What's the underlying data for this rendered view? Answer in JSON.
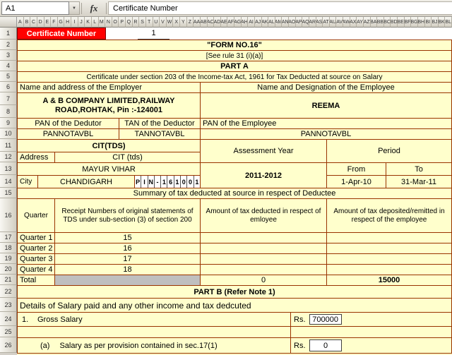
{
  "window": {
    "formula_bar": {
      "cell_reference": "A1",
      "dropdown_icon": "▼",
      "fx_label": "fx",
      "formula_content": "Certificate Number"
    },
    "grid": {
      "column_headers": [
        "A",
        "B",
        "C",
        "D",
        "E",
        "F",
        "G",
        "H",
        "I",
        "J",
        "K",
        "L",
        "M",
        "N",
        "O",
        "P",
        "Q",
        "R",
        "S",
        "T",
        "U",
        "V",
        "W",
        "X",
        "Y",
        "Z",
        "AA",
        "AB",
        "AC",
        "AD",
        "AE",
        "AF",
        "AG",
        "AH",
        "AI",
        "AJ",
        "AK",
        "AL",
        "AM",
        "AN",
        "AO",
        "AP",
        "AQ",
        "AR",
        "AS",
        "AT",
        "AU",
        "AV",
        "AW",
        "AX",
        "AY",
        "AZ",
        "BA",
        "BB",
        "BC",
        "BD",
        "BE",
        "BF",
        "BG",
        "BH",
        "BI",
        "BJ",
        "BK",
        "BL"
      ],
      "row_headers": [
        "1",
        "2",
        "3",
        "4",
        "5",
        "6",
        "7",
        "8",
        "9",
        "10",
        "11",
        "12",
        "13",
        "14",
        "15",
        "16",
        "17",
        "18",
        "19",
        "20",
        "21",
        "22",
        "23",
        "24",
        "25",
        "26"
      ]
    }
  },
  "form": {
    "certificate_number_label": "Certificate Number",
    "certificate_number_value": "1",
    "title": "\"FORM NO.16\"",
    "rule": "[See rule 31 (i)(a)]",
    "part_a": "PART A",
    "certificate_line": "Certificate under section 203 of the Income-tax Act, 1961 for Tax Deducted at source on Salary",
    "employer_header": "Name and address of the Employer",
    "employee_header": "Name and Designation of the Employee",
    "employer_name_line1": "A & B COMPANY LIMITED,RAILWAY",
    "employer_name_line2": "ROAD,ROHTAK, Pin :-124001",
    "employee_name": "REEMA",
    "pan_deductor_label": "PAN of the Dedutor",
    "tan_deductor_label": "TAN of the Deductor",
    "pan_employee_label": "PAN of the Employee",
    "pan_deductor": "PANNOTAVBL",
    "tan_deductor": "TANNOTAVBL",
    "pan_employee": "PANNOTAVBL",
    "cit_tds_label": "CIT(TDS)",
    "assessment_year_label": "Assessment Year",
    "period_label": "Period",
    "address_label": "Address",
    "cit_value": "CIT (tds)",
    "address_value": "MAYUR VIHAR",
    "assessment_year": "2011-2012",
    "from_label": "From",
    "to_label": "To",
    "city_label": "City",
    "city_value": "CHANDIGARH",
    "pin_chars": [
      "P",
      "I",
      "N",
      "-",
      "1",
      "6",
      "1",
      "0",
      "0",
      "1"
    ],
    "period_from": "1-Apr-10",
    "period_to": "31-Mar-11",
    "summary_title": "Summary of tax deducted at source in respect of Deductee",
    "summary_table": {
      "headers": [
        "Quarter",
        "Receipt Numbers of original statements of TDS under sub-section (3) of section 200",
        "Amount of tax deducted in respect of emloyee",
        "Amount of tax deposited/remitted in respect of the employee"
      ],
      "rows": [
        {
          "quarter": "Quarter 1",
          "receipt": "15",
          "deducted": "",
          "deposited": ""
        },
        {
          "quarter": "Quarter 2",
          "receipt": "16",
          "deducted": "",
          "deposited": ""
        },
        {
          "quarter": "Quarter 3",
          "receipt": "17",
          "deducted": "",
          "deposited": ""
        },
        {
          "quarter": "Quarter 4",
          "receipt": "18",
          "deducted": "",
          "deposited": ""
        }
      ],
      "total_label": "Total",
      "total_deducted": "0",
      "total_deposited": "15000"
    },
    "part_b": "PART B (Refer Note 1)",
    "details_title": "Details of Salary paid and any other income and tax dedcuted",
    "gross_salary": {
      "number": "1.",
      "label": "Gross Salary",
      "rs_label": "Rs.",
      "value": "700000"
    },
    "salary_sec17": {
      "letter": "(a)",
      "label": "Salary as per provision contained in sec.17(1)",
      "rs_label": "Rs.",
      "value": "0"
    }
  },
  "colors": {
    "cell_background": "#FFFFCC",
    "form_border": "#993300",
    "certificate_label_background": "#FF0000",
    "certificate_label_text": "#FFFFFF",
    "total_receipt_cell_background": "#BFBFBF"
  }
}
